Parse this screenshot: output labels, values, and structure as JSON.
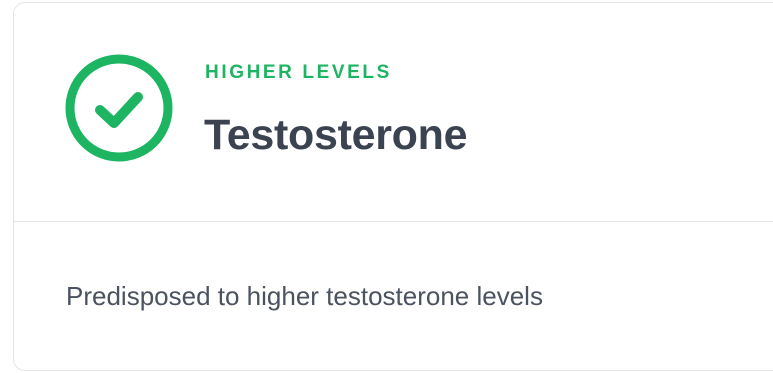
{
  "trait": {
    "status_label": "HIGHER LEVELS",
    "title": "Testosterone",
    "description": "Predisposed to higher testosterone levels",
    "status_icon": "check-circle-icon",
    "status_color": "#1db462"
  }
}
